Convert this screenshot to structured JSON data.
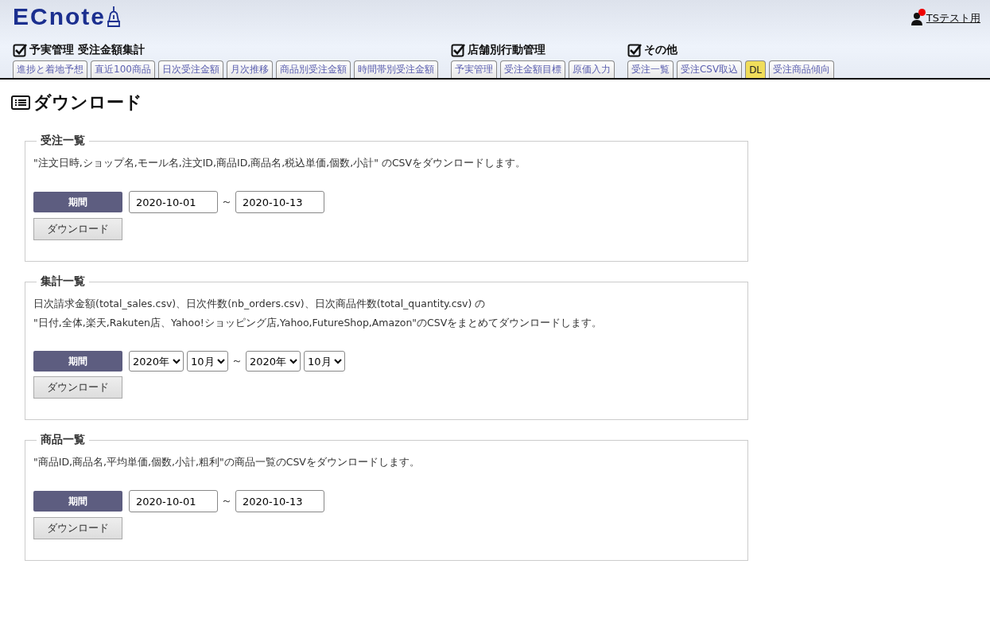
{
  "logo": "ECnote",
  "user": {
    "name": "TSテスト用",
    "alert": true
  },
  "nav_groups": [
    {
      "title": "予実管理 受注金額集計",
      "checked": true,
      "tabs": [
        {
          "label": "進捗と着地予想",
          "selected": false
        },
        {
          "label": "直近100商品",
          "selected": false
        },
        {
          "label": "日次受注金額",
          "selected": false
        },
        {
          "label": "月次推移",
          "selected": false
        },
        {
          "label": "商品別受注金額",
          "selected": false
        },
        {
          "label": "時間帯別受注金額",
          "selected": false
        }
      ]
    },
    {
      "title": "店舗別行動管理",
      "checked": true,
      "tabs": [
        {
          "label": "予実管理",
          "selected": false
        },
        {
          "label": "受注金額目標",
          "selected": false
        },
        {
          "label": "原価入力",
          "selected": false
        }
      ]
    },
    {
      "title": "その他",
      "checked": true,
      "tabs": [
        {
          "label": "受注一覧",
          "selected": false
        },
        {
          "label": "受注CSV取込",
          "selected": false
        },
        {
          "label": "DL",
          "selected": true
        },
        {
          "label": "受注商品傾向",
          "selected": false
        }
      ]
    }
  ],
  "page_title": "ダウンロード",
  "sections": [
    {
      "kind": "date",
      "legend": "受注一覧",
      "description": [
        "\"注文日時,ショップ名,モール名,注文ID,商品ID,商品名,税込単価,個数,小計\" のCSVをダウンロードします。"
      ],
      "period_label": "期間",
      "from": [
        "2020-10-01"
      ],
      "separator": "～",
      "to": [
        "2020-10-13"
      ],
      "button": "ダウンロード"
    },
    {
      "kind": "month",
      "legend": "集計一覧",
      "description": [
        "日次請求金額(total_sales.csv)、日次件数(nb_orders.csv)、日次商品件数(total_quantity.csv) の",
        "\"日付,全体,楽天,Rakuten店、Yahoo!ショッピング店,Yahoo,FutureShop,Amazon\"のCSVをまとめてダウンロードします。"
      ],
      "period_label": "期間",
      "from": [
        "2020年",
        "10月"
      ],
      "separator": "～",
      "to": [
        "2020年",
        "10月"
      ],
      "button": "ダウンロード"
    },
    {
      "kind": "date",
      "legend": "商品一覧",
      "description": [
        "\"商品ID,商品名,平均単価,個数,小計,粗利\"の商品一覧のCSVをダウンロードします。"
      ],
      "period_label": "期間",
      "from": [
        "2020-10-01"
      ],
      "separator": "～",
      "to": [
        "2020-10-13"
      ],
      "button": "ダウンロード"
    }
  ]
}
